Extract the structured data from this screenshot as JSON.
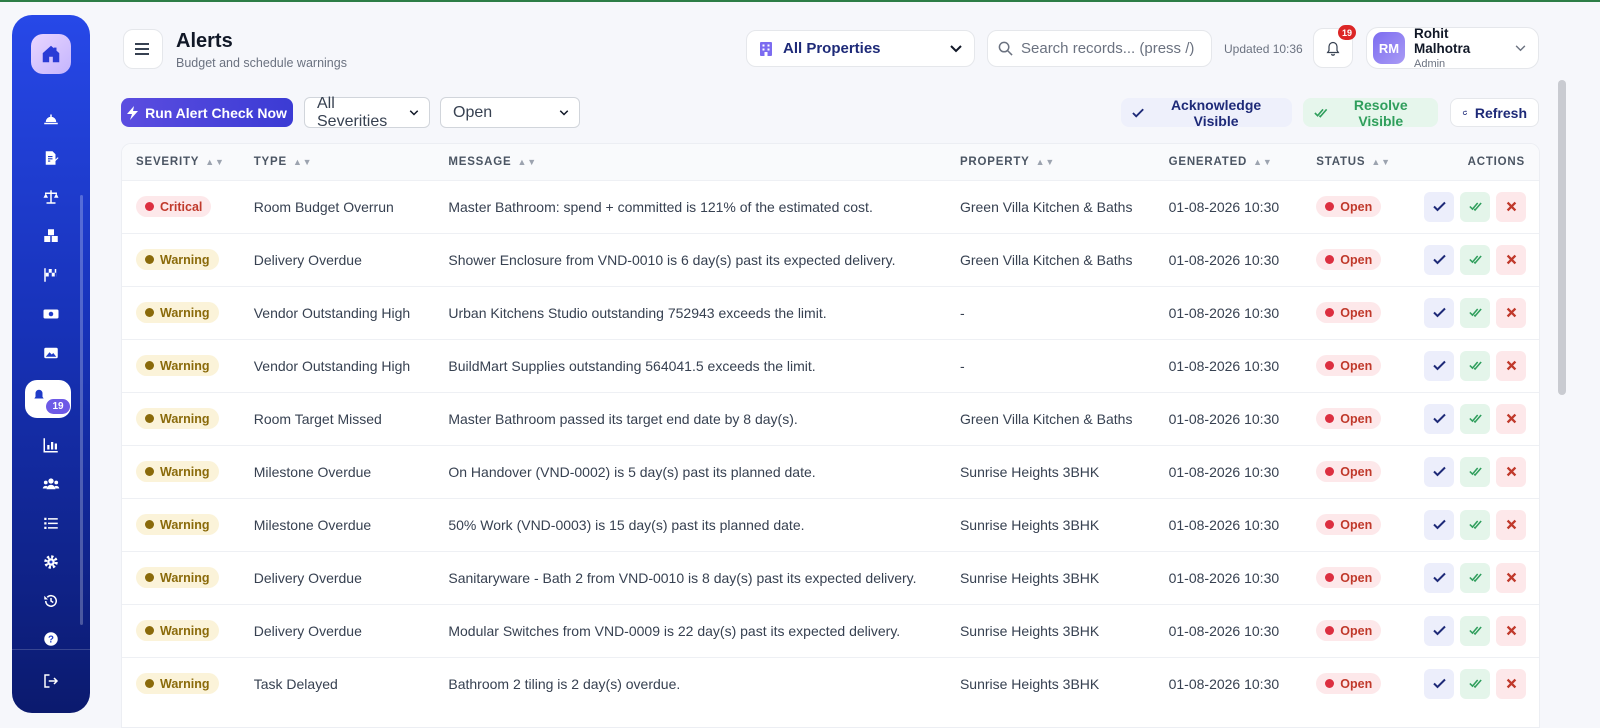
{
  "header": {
    "title": "Alerts",
    "subtitle": "Budget and schedule warnings",
    "property_select": "All Properties",
    "search_placeholder": "Search records... (press /)",
    "updated": "Updated 10:36",
    "notification_count": "19"
  },
  "user": {
    "initials": "RM",
    "name": "Rohit Malhotra",
    "role": "Admin"
  },
  "sidebar": {
    "alerts_badge": "19"
  },
  "toolbar": {
    "run_check": "Run Alert Check Now",
    "severity_filter": "All Severities",
    "status_filter": "Open",
    "acknowledge_visible": "Acknowledge Visible",
    "resolve_visible": "Resolve Visible",
    "refresh": "Refresh"
  },
  "table": {
    "columns": [
      "SEVERITY",
      "TYPE",
      "MESSAGE",
      "PROPERTY",
      "GENERATED",
      "STATUS",
      "ACTIONS"
    ],
    "rows": [
      {
        "severity": "Critical",
        "type": "Room Budget Overrun",
        "message": "Master Bathroom: spend + committed is 121% of the estimated cost.",
        "property": "Green Villa Kitchen & Baths",
        "generated": "01-08-2026 10:30",
        "status": "Open"
      },
      {
        "severity": "Warning",
        "type": "Delivery Overdue",
        "message": "Shower Enclosure from VND-0010 is 6 day(s) past its expected delivery.",
        "property": "Green Villa Kitchen & Baths",
        "generated": "01-08-2026 10:30",
        "status": "Open"
      },
      {
        "severity": "Warning",
        "type": "Vendor Outstanding High",
        "message": "Urban Kitchens Studio outstanding 752943 exceeds the limit.",
        "property": "-",
        "generated": "01-08-2026 10:30",
        "status": "Open"
      },
      {
        "severity": "Warning",
        "type": "Vendor Outstanding High",
        "message": "BuildMart Supplies outstanding 564041.5 exceeds the limit.",
        "property": "-",
        "generated": "01-08-2026 10:30",
        "status": "Open"
      },
      {
        "severity": "Warning",
        "type": "Room Target Missed",
        "message": "Master Bathroom passed its target end date by 8 day(s).",
        "property": "Green Villa Kitchen & Baths",
        "generated": "01-08-2026 10:30",
        "status": "Open"
      },
      {
        "severity": "Warning",
        "type": "Milestone Overdue",
        "message": "On Handover (VND-0002) is 5 day(s) past its planned date.",
        "property": "Sunrise Heights 3BHK",
        "generated": "01-08-2026 10:30",
        "status": "Open"
      },
      {
        "severity": "Warning",
        "type": "Milestone Overdue",
        "message": "50% Work (VND-0003) is 15 day(s) past its planned date.",
        "property": "Sunrise Heights 3BHK",
        "generated": "01-08-2026 10:30",
        "status": "Open"
      },
      {
        "severity": "Warning",
        "type": "Delivery Overdue",
        "message": "Sanitaryware - Bath 2 from VND-0010 is 8 day(s) past its expected delivery.",
        "property": "Sunrise Heights 3BHK",
        "generated": "01-08-2026 10:30",
        "status": "Open"
      },
      {
        "severity": "Warning",
        "type": "Delivery Overdue",
        "message": "Modular Switches from VND-0009 is 22 day(s) past its expected delivery.",
        "property": "Sunrise Heights 3BHK",
        "generated": "01-08-2026 10:30",
        "status": "Open"
      },
      {
        "severity": "Warning",
        "type": "Task Delayed",
        "message": "Bathroom 2 tiling is 2 day(s) overdue.",
        "property": "Sunrise Heights 3BHK",
        "generated": "01-08-2026 10:30",
        "status": "Open"
      }
    ]
  },
  "colors": {
    "accent": "#3b3bd4",
    "critical": "#dc2f40",
    "warning": "#8a6a0a",
    "success": "#2f9e5c"
  }
}
